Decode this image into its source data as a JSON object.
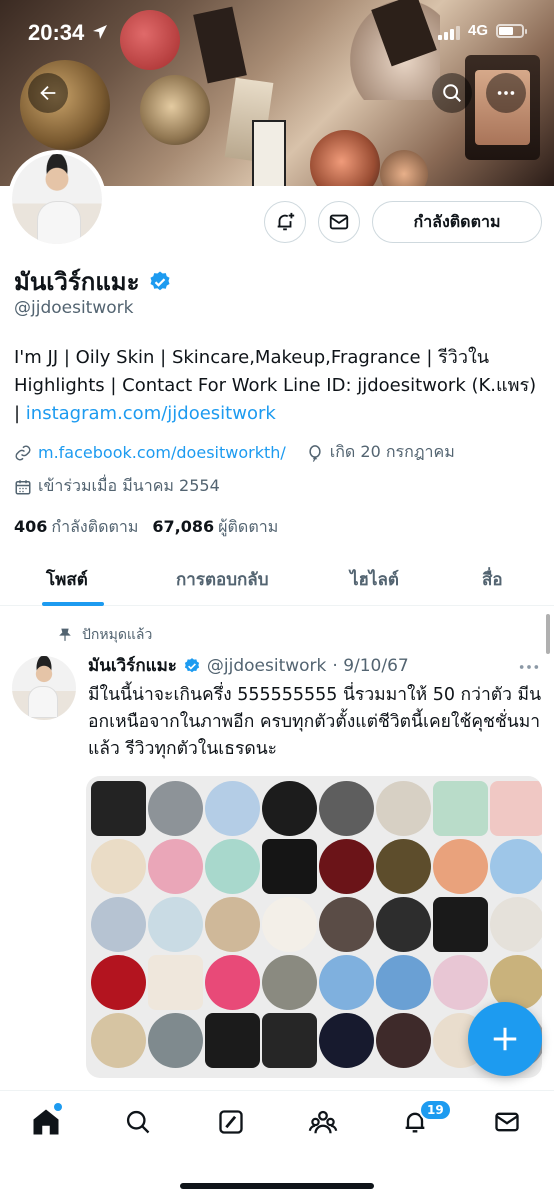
{
  "status_bar": {
    "time": "20:34",
    "network": "4G"
  },
  "profile": {
    "name": "มันเวิร์กแมะ",
    "handle": "@jjdoesitwork",
    "follow_button": "กำลังติดตาม",
    "bio_text": "I'm JJ | Oily Skin | Skincare,Makeup,Fragrance | รีวิวใน Highlights | Contact For Work Line ID: jjdoesitwork (K.แพร) | ",
    "bio_link": "instagram.com/jjdoesitwork",
    "website": "m.facebook.com/doesitworkth/",
    "birthday": "เกิด 20 กรกฎาคม",
    "joined": "เข้าร่วมเมื่อ มีนาคม 2554",
    "following_count": "406",
    "following_label": "กำลังติดตาม",
    "followers_count": "67,086",
    "followers_label": "ผู้ติดตาม"
  },
  "tabs": [
    {
      "label": "โพสต์",
      "active": true
    },
    {
      "label": "การตอบกลับ",
      "active": false
    },
    {
      "label": "ไฮไลต์",
      "active": false
    },
    {
      "label": "สื่อ",
      "active": false
    }
  ],
  "tweet": {
    "pinned_label": "ปักหมุดแล้ว",
    "author_name": "มันเวิร์กแมะ",
    "author_handle": "@jjdoesitwork",
    "date": "· 9/10/67",
    "text": "มีในนี้น่าจะเกินครึ่ง 555555555 นี่รวมมาให้ 50 กว่าตัว มีนอกเหนือจากในภาพอีก ครบทุกตัวตั้งแต่ชีวิตนี้เคยใช้คุชชั่นมาแล้ว รีวิวทุกตัวในเธรดนะ"
  },
  "nav": {
    "notification_count": "19"
  },
  "colors": {
    "accent": "#1d9bf0",
    "text": "#0f1419",
    "muted": "#536471",
    "border": "#cfd9de"
  },
  "icons": [
    "back-arrow-icon",
    "search-icon",
    "more-icon",
    "bell-plus-icon",
    "mail-icon",
    "verified-icon",
    "link-icon",
    "balloon-icon",
    "calendar-icon",
    "pin-icon",
    "plus-icon",
    "home-icon",
    "grok-icon",
    "communities-icon",
    "bell-icon",
    "envelope-icon"
  ]
}
